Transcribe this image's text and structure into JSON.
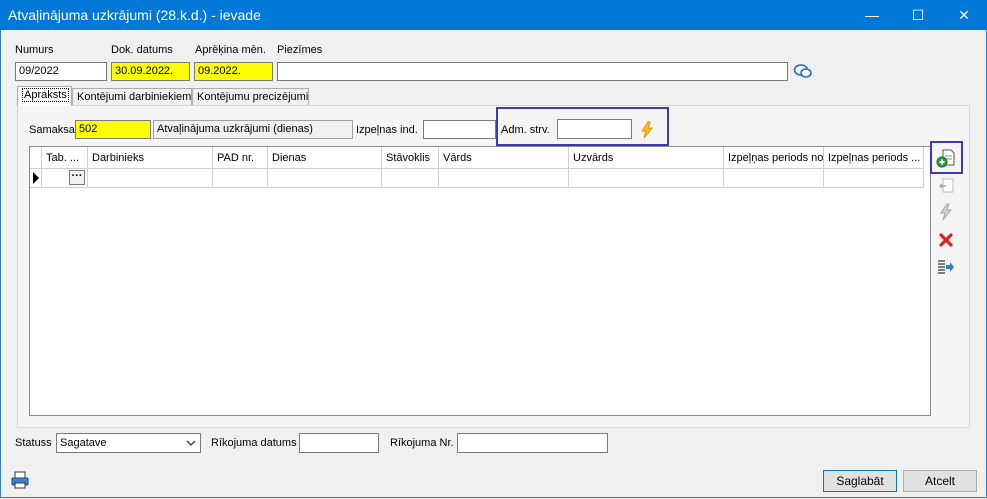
{
  "window": {
    "title": "Atvaļinājuma uzkrājumi (28.k.d.) - ievade",
    "minimize": "—",
    "maximize": "☐",
    "close": "✕"
  },
  "header": {
    "numurs_label": "Numurs",
    "numurs_value": "09/2022",
    "dok_datums_label": "Dok. datums",
    "dok_datums_value": "30.09.2022.",
    "aprekina_men_label": "Aprēķina mēn.",
    "aprekina_men_value": "09.2022.",
    "piezimes_label": "Piezīmes",
    "piezimes_value": ""
  },
  "tabs": [
    {
      "label": "Apraksts",
      "active": true
    },
    {
      "label": "Kontējumi darbiniekiem",
      "active": false
    },
    {
      "label": "Kontējumu precizējumi",
      "active": false
    }
  ],
  "form": {
    "samaksa_label": "Samaksa",
    "samaksa_code": "502",
    "samaksa_name": "Atvaļinājuma uzkrājumi (dienas)",
    "izpelnas_ind_label": "Izpeļnas ind.",
    "izpelnas_ind_value": "",
    "adm_strv_label": "Adm. strv.",
    "adm_strv_value": ""
  },
  "grid": {
    "columns": [
      "Tab. ...",
      "Darbinieks",
      "PAD nr.",
      "Dienas",
      "Stāvoklis",
      "Vārds",
      "Uzvārds",
      "Izpeļņas periods no",
      "Izpeļnas periods ..."
    ],
    "ellipsis": "···"
  },
  "footer": {
    "statuss_label": "Statuss",
    "statuss_value": "Sagatave",
    "rikojuma_datums_label": "Rīkojuma datums",
    "rikojuma_datums_value": "",
    "rikojuma_nr_label": "Rīkojuma Nr.",
    "rikojuma_nr_value": "",
    "save_label": "Saglabāt",
    "cancel_label": "Atcelt"
  },
  "colors": {
    "titlebar": "#0078d7",
    "required_field": "#ffff00",
    "highlight": "#3a3ab8"
  }
}
